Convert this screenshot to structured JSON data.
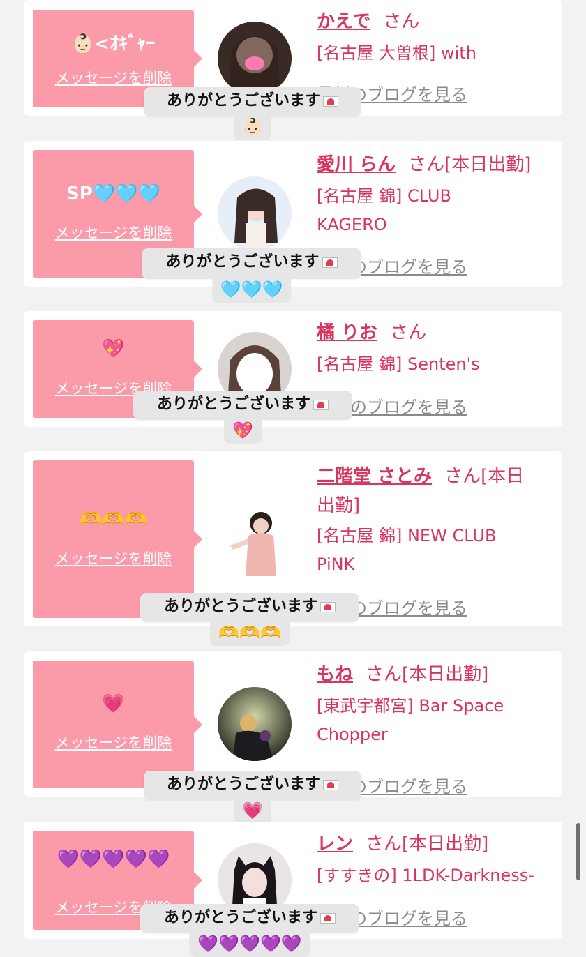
{
  "reaction_text": "ありがとうございます",
  "delete_label": "メッセージを削除",
  "san_label": "さん",
  "blog_label": "最新のブログを見る",
  "accent_color": "#fb9aa9",
  "link_color": "#d8365e",
  "items": [
    {
      "message": "👶🏻<ｵｷﾞｬｰ",
      "name": "かえで",
      "status": "",
      "shop": "[名古屋 大曽根] with",
      "reaction_emoji": "👶🏻"
    },
    {
      "message": "SP🩵🩵🩵",
      "name": "愛川 らん",
      "status": "[本日出勤]",
      "shop": "[名古屋 錦] CLUB KAGERO",
      "reaction_emoji": "🩵🩵🩵"
    },
    {
      "message": "💖",
      "name": "橘 りお",
      "status": "",
      "shop": "[名古屋 錦] Senten's",
      "reaction_emoji": "💖"
    },
    {
      "message": "🫶🫶🫶",
      "name": "二階堂 さとみ",
      "status": "[本日出勤]",
      "shop": "[名古屋 錦] NEW CLUB PiNK",
      "reaction_emoji": "🫶🫶🫶"
    },
    {
      "message": "💗",
      "name": "もね",
      "status": "[本日出勤]",
      "shop": "[東武宇都宮] Bar Space Chopper",
      "reaction_emoji": "💗"
    },
    {
      "message": "💜💜💜💜💜",
      "name": "レン",
      "status": "[本日出勤]",
      "shop": "[すすきの] 1LDK-Darkness-",
      "reaction_emoji": "💜💜💜💜💜"
    }
  ]
}
